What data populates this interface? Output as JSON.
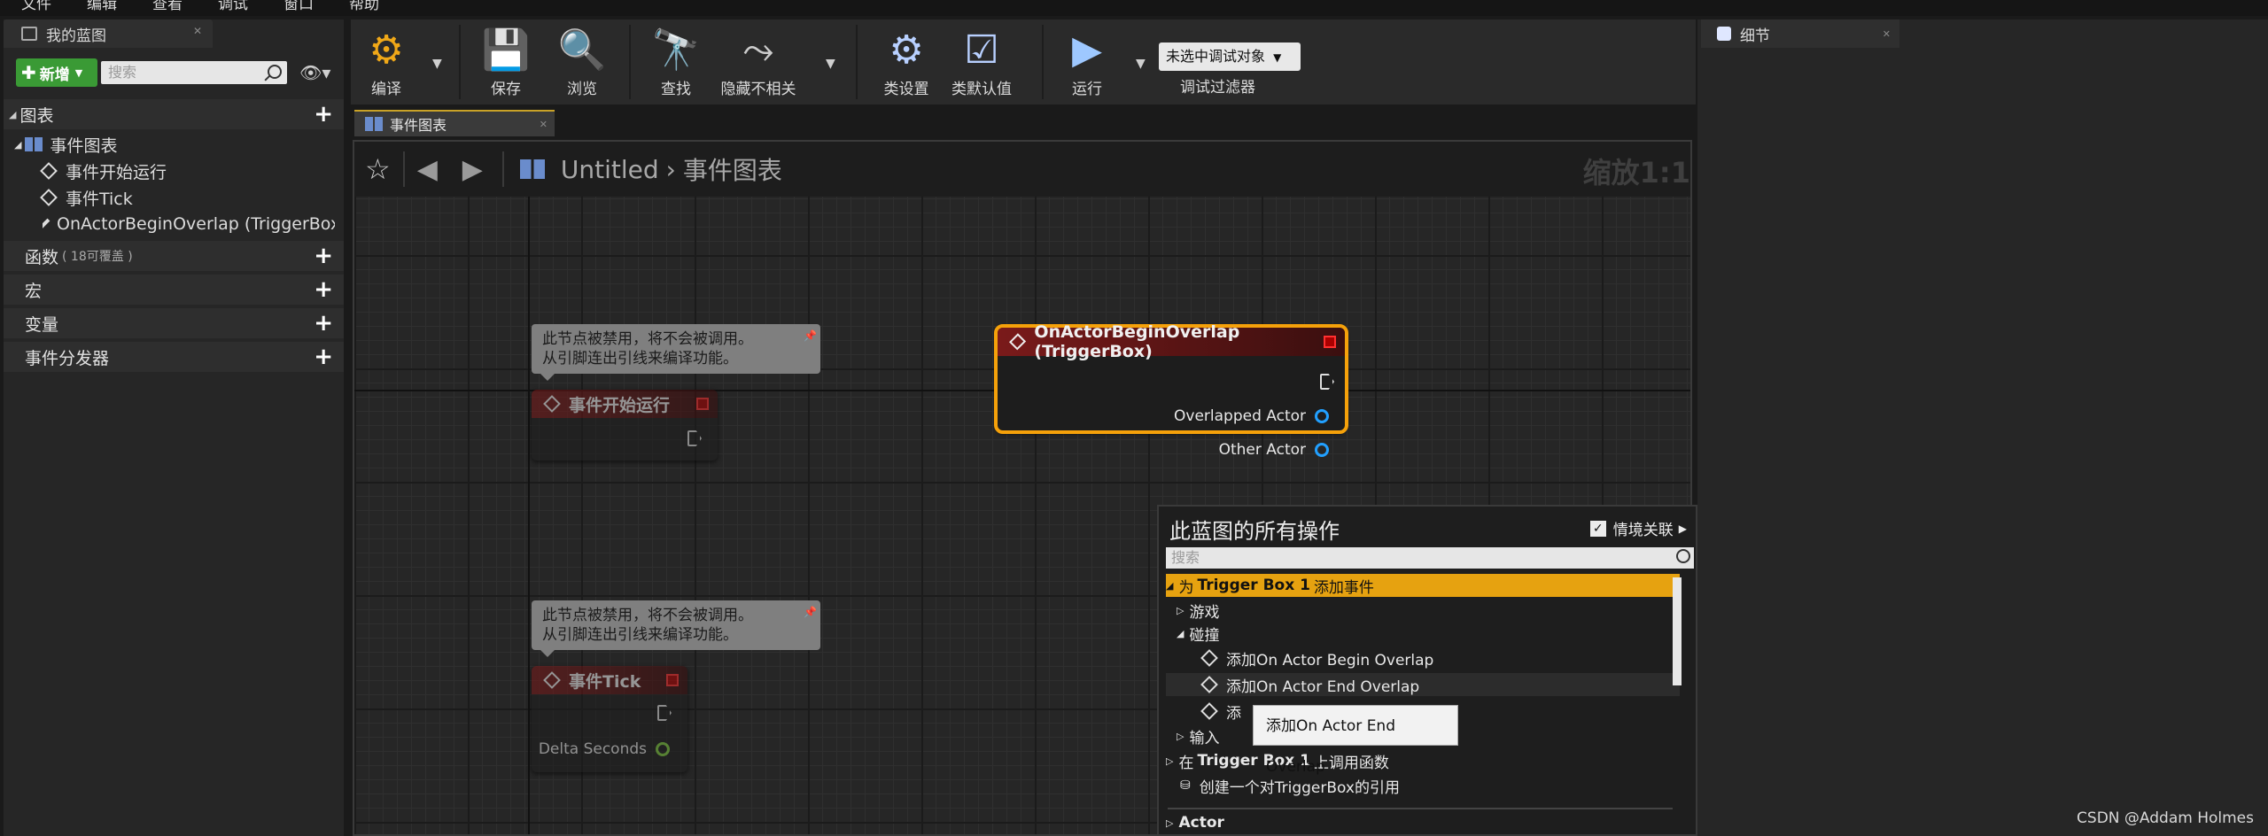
{
  "menubar": [
    "文件",
    "编辑",
    "查看",
    "调试",
    "窗口",
    "帮助"
  ],
  "left_panel": {
    "tab": "我的蓝图",
    "add_button": "新增",
    "search_placeholder": "搜索",
    "sections": {
      "graphs": "图表",
      "functions": "函数",
      "functions_note": "( 18可覆盖 )",
      "macros": "宏",
      "variables": "变量",
      "dispatchers": "事件分发器"
    },
    "event_graph": "事件图表",
    "events": [
      "事件开始运行",
      "事件Tick",
      "OnActorBeginOverlap (TriggerBox)"
    ]
  },
  "toolbar": {
    "compile": "编译",
    "save": "保存",
    "browse": "浏览",
    "find": "查找",
    "hide_unrelated": "隐藏不相关",
    "class_settings": "类设置",
    "class_defaults": "类默认值",
    "run": "运行",
    "debug_target": "未选中调试对象",
    "debug_filter": "调试过滤器"
  },
  "graph_tab": "事件图表",
  "breadcrumb": {
    "asset": "Untitled",
    "graph": "事件图表",
    "zoom": "缩放1:1"
  },
  "comments": {
    "disabled_line1": "此节点被禁用，将不会被调用。",
    "disabled_line2": "从引脚连出引线来编译功能。"
  },
  "nodes": {
    "begin_play": "事件开始运行",
    "tick": "事件Tick",
    "tick_pin": "Delta Seconds",
    "overlap": "OnActorBeginOverlap (TriggerBox)",
    "overlap_pin1": "Overlapped Actor",
    "overlap_pin2": "Other Actor"
  },
  "action_menu": {
    "title": "此蓝图的所有操作",
    "context": "情境关联",
    "search_placeholder": "搜索",
    "add_event_pre": "为",
    "add_event_bold": "Trigger Box 1",
    "add_event_post": "添加事件",
    "game": "游戏",
    "collision": "碰撞",
    "add_begin": "添加On Actor Begin Overlap",
    "add_end": "添加On Actor End Overlap",
    "add_partial": "添",
    "input": "输入",
    "call_pre": "在",
    "call_bold": "Trigger Box 1",
    "call_post": "上调用函数",
    "create_ref": "创建一个对TriggerBox的引用",
    "actor": "Actor",
    "tooltip": "添加On Actor End Overlap"
  },
  "right_panel": {
    "tab": "细节"
  },
  "watermark": "CSDN @Addam Holmes",
  "colors": {
    "accent": "#e6a210",
    "event_head": "#7a1a1a",
    "pin_object": "#22a0ff",
    "pin_float": "#7ecb3e",
    "add_green": "#3a9a35"
  }
}
